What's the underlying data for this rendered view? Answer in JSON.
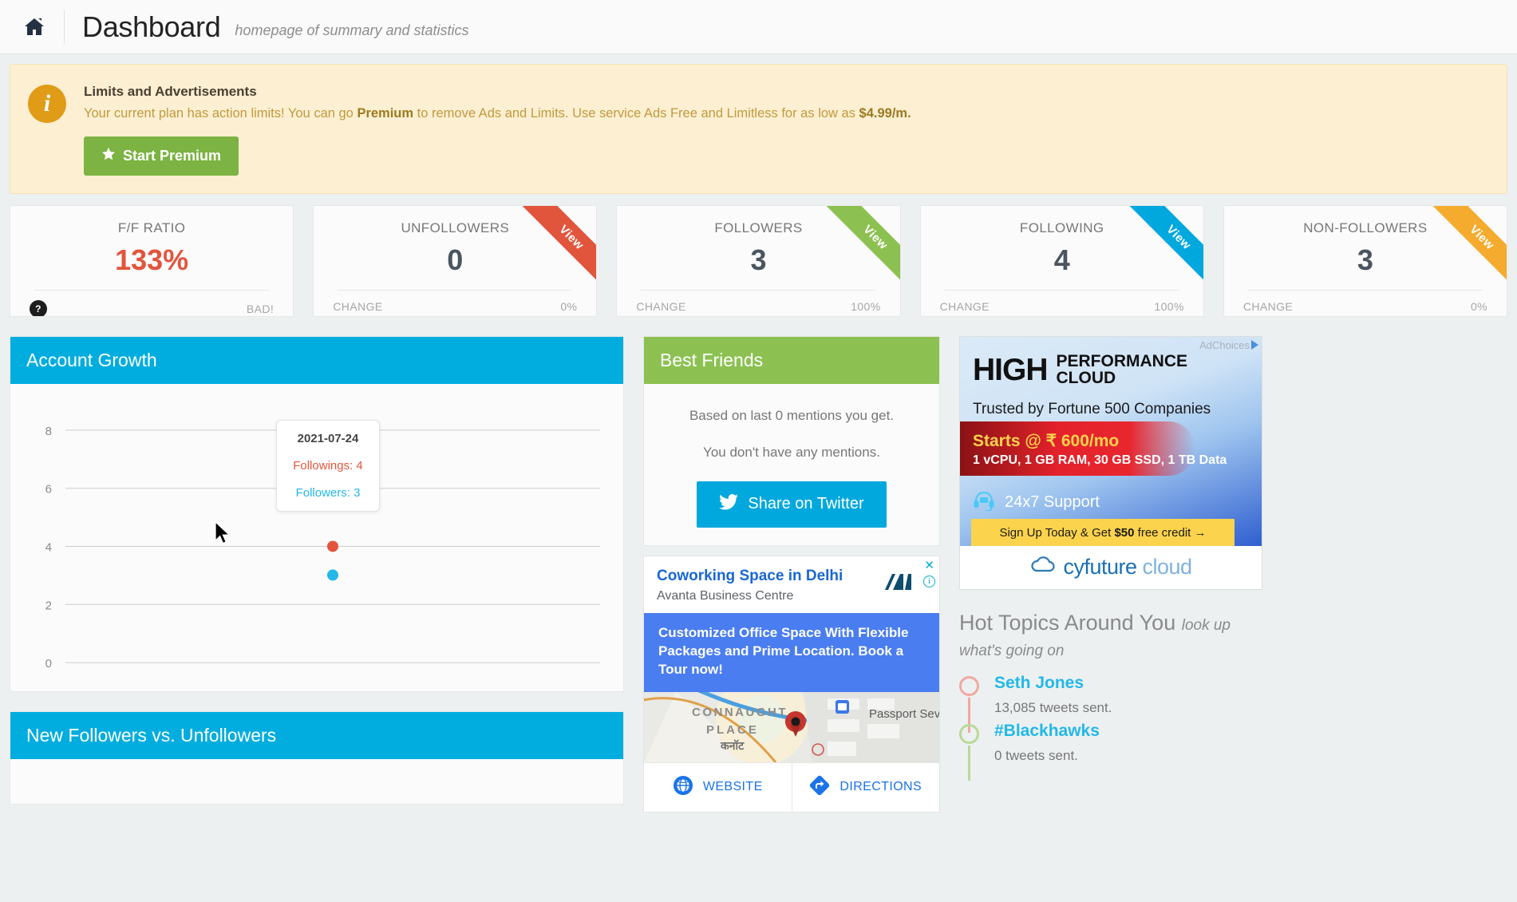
{
  "header": {
    "home_icon": "home-icon",
    "title": "Dashboard",
    "subtitle": "homepage of summary and statistics"
  },
  "alert": {
    "title": "Limits and Advertisements",
    "text_part1": "Your current plan has action limits! You can go ",
    "text_bold1": "Premium",
    "text_part2": " to remove Ads and Limits. Use service Ads Free and Limitless for as low as ",
    "text_bold2": "$4.99/m.",
    "button_label": "Start Premium",
    "button_icon": "star-icon",
    "info_icon": "info-icon",
    "accent": "#e09b17",
    "button_color": "#7cb342"
  },
  "stats": [
    {
      "label": "F/F RATIO",
      "value": "133%",
      "value_state": "bad",
      "foot_left": "",
      "foot_left_icon": "question-mark-icon",
      "foot_right": "BAD!",
      "ribbon": null,
      "ribbon_color": null
    },
    {
      "label": "UNFOLLOWERS",
      "value": "0",
      "value_state": "normal",
      "foot_left": "CHANGE",
      "foot_right": "0%",
      "ribbon": "View",
      "ribbon_color": "#e2553d"
    },
    {
      "label": "FOLLOWERS",
      "value": "3",
      "value_state": "normal",
      "foot_left": "CHANGE",
      "foot_right": "100%",
      "ribbon": "View",
      "ribbon_color": "#8cc152"
    },
    {
      "label": "FOLLOWING",
      "value": "4",
      "value_state": "normal",
      "foot_left": "CHANGE",
      "foot_right": "100%",
      "ribbon": "View",
      "ribbon_color": "#00a8dd"
    },
    {
      "label": "NON-FOLLOWERS",
      "value": "3",
      "value_state": "normal",
      "foot_left": "CHANGE",
      "foot_right": "0%",
      "ribbon": "View",
      "ribbon_color": "#f5ab2e"
    }
  ],
  "account_growth": {
    "panel_title": "Account Growth",
    "panel_color": "#00adde",
    "tooltip": {
      "date": "2021-07-24",
      "followings": "Followings: 4",
      "followers": "Followers: 3"
    }
  },
  "chart_data": {
    "type": "line",
    "title": "Account Growth",
    "x": [
      "2021-07-24"
    ],
    "xlabel": "",
    "ylabel": "",
    "ylim": [
      0,
      8
    ],
    "yticks": [
      0,
      2,
      4,
      6,
      8
    ],
    "grid": true,
    "legend": "none",
    "series": [
      {
        "name": "Followings",
        "values": [
          4
        ],
        "color": "#e2553d"
      },
      {
        "name": "Followers",
        "values": [
          3
        ],
        "color": "#22b8e8"
      }
    ]
  },
  "best_friends": {
    "panel_title": "Best Friends",
    "panel_color": "#8cc152",
    "line1": "Based on last 0 mentions you get.",
    "line2": "You don't have any mentions.",
    "share_button": "Share on Twitter",
    "share_icon": "twitter-icon"
  },
  "google_ad": {
    "title": "Coworking Space in Delhi",
    "subtitle": "Avanta Business Centre",
    "banner": "Customized Office Space With Flexible Packages and Prime Location. Book a Tour now!",
    "close_icon": "close-icon",
    "info_icon": "ad-info-icon",
    "map_labels": [
      "CONNAUGHT",
      "PLACE",
      "कनॉट",
      "Passport Sev"
    ],
    "actions": [
      {
        "label": "WEBSITE",
        "icon": "globe-icon"
      },
      {
        "label": "DIRECTIONS",
        "icon": "directions-icon"
      }
    ]
  },
  "right_ad": {
    "adchoices": "AdChoices",
    "headline_big": "HIGH",
    "headline_small_line1": "PERFORMANCE",
    "headline_small_line2": "CLOUD",
    "tagline": "Trusted by Fortune 500 Companies",
    "price": "Starts @ ₹ 600/mo",
    "specs": "1 vCPU, 1 GB RAM, 30 GB SSD, 1 TB Data",
    "support": "24x7 Support",
    "support_icon": "headset-icon",
    "cta_pre": "Sign Up Today & Get ",
    "cta_bold": "$50",
    "cta_post": " free credit  →",
    "brand_1": "cyfuture",
    "brand_2": " cloud",
    "brand_icon": "cloud-icon"
  },
  "hot_topics": {
    "heading": "Hot Topics Around You",
    "heading_italic": "look up what's going on",
    "items": [
      {
        "title": "Seth Jones",
        "count": "13,085 tweets sent.",
        "dot_color": "#f0a9a0"
      },
      {
        "title": "#Blackhawks",
        "count": "0 tweets sent.",
        "dot_color": "#b9d99a"
      }
    ]
  },
  "new_followers_panel": {
    "panel_title": "New Followers vs. Unfollowers",
    "panel_color": "#00adde"
  }
}
